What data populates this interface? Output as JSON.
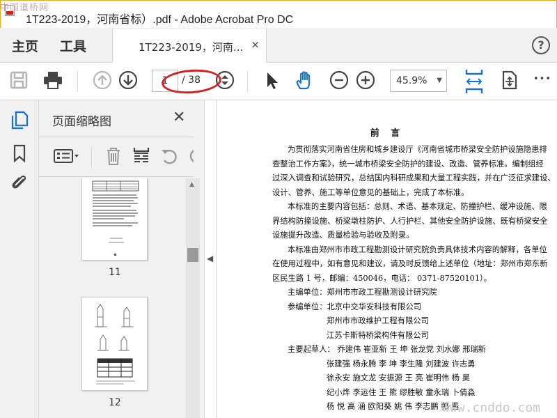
{
  "window": {
    "title": "1T223-2019，河南省标）.pdf - Adobe Acrobat Pro DC"
  },
  "menu": {
    "home": "主页",
    "tools": "工具",
    "help": "?"
  },
  "tab": {
    "label": "1T223-2019，河南...",
    "close": "×"
  },
  "toolbar": {
    "page_current": "1",
    "page_total": "/ 38",
    "zoom": "45.9%",
    "zoom_arrow": "▼",
    "more": "•••"
  },
  "thumbnails_panel": {
    "title": "页面缩略图",
    "close": "✕",
    "pages": [
      {
        "label": "11"
      },
      {
        "label": "12"
      }
    ]
  },
  "document": {
    "heading": "前 言",
    "lines": [
      {
        "text": "为贯彻落实河南省住房和城乡建设厅《河南省城市桥梁安全防护设施隐患排",
        "cls": "ind"
      },
      {
        "text": "查整治工作方案》，统一城市桥梁安全防护的建设、改造、管养标准。编制组经",
        "cls": ""
      },
      {
        "text": "过深入调查和试验研究，总结国内科研成果和大量工程实践，并在广泛征求建设、",
        "cls": ""
      },
      {
        "text": "设计、管养、施工等单位意见的基础上，完成了本标准。",
        "cls": ""
      },
      {
        "text": "本标准的主要内容包括：总则、术语、基本规定、防撞护栏、缓冲设施、限",
        "cls": "ind"
      },
      {
        "text": "界结构防撞设施、桥梁墩柱防护、人行护栏、其他安全防护设施、既有桥梁安全",
        "cls": ""
      },
      {
        "text": "设施提升改造、质量检验与验收及附录。",
        "cls": ""
      },
      {
        "text": "本标准由郑州市市政工程勘测设计研究院负责具体技术内容的解释，各单位",
        "cls": "ind"
      },
      {
        "text": "在使用过程中，如有意见和建议，请及时反馈给上述单位（地址：郑州市郑东新",
        "cls": ""
      },
      {
        "text": "区民生路 1 号，邮编：450046，电话：  0371-87520101）。",
        "cls": ""
      },
      {
        "text": "主编单位：郑州市市政工程勘测设计研究院",
        "cls": "ind"
      },
      {
        "text": "参编单位：北京中交华安科技有限公司",
        "cls": "ind"
      },
      {
        "text": "郑州市市政维护工程有限公司",
        "cls": "org"
      },
      {
        "text": "江苏卡斯特桥梁构件有限公司",
        "cls": "org"
      },
      {
        "text": "主要起草人：  乔建伟   崔亚新    王    坤   张龙党     刘水娜    邢瑞新",
        "cls": "ind"
      },
      {
        "text": "张建强   杨永腾    李    坤   李生隆     刘建波    许志勇",
        "cls": "org"
      },
      {
        "text": "徐永安   施文龙   安振源    王    亮    崔明伟    杨    昊",
        "cls": "org"
      },
      {
        "text": "纪小烨   李运住    王    熊   缪胜敏     童永瑞    卜倩淼",
        "cls": "org"
      },
      {
        "text": "杨    悦   高    涵   欧阳葵    姚    伟   李志鹏    郭    晋",
        "cls": "org"
      }
    ]
  },
  "watermarks": {
    "top_left": "中国道桥网",
    "bottom_right": "www.cnddo.com"
  },
  "colors": {
    "accent_blue": "#1a73c9",
    "annotation_red": "#d42020",
    "title_border": "#e1ae21"
  }
}
